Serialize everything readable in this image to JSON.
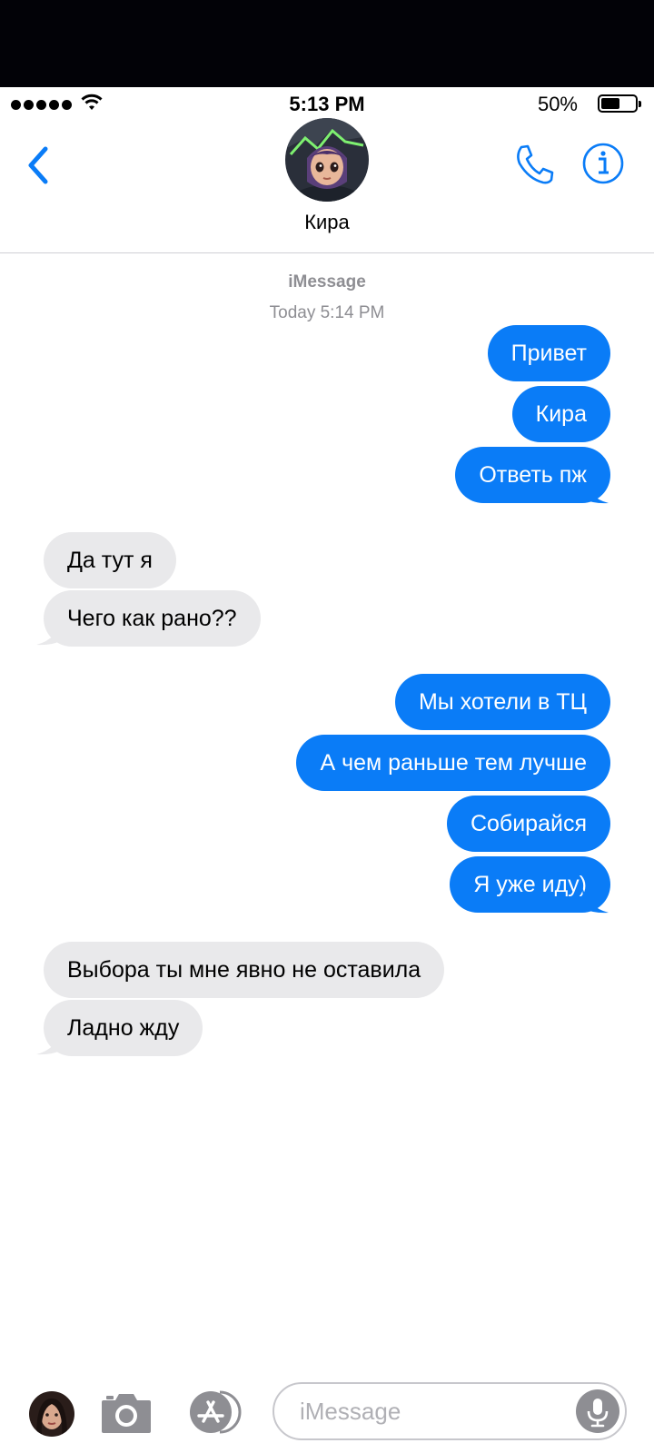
{
  "status_bar": {
    "time": "5:13 PM",
    "battery_percent": "50%",
    "battery_level": 0.5,
    "signal_bars": 5
  },
  "header": {
    "contact_name": "Кира",
    "back_icon": "chevron-left-icon",
    "call_icon": "phone-icon",
    "info_icon": "info-icon",
    "accent_color": "#0a7cf7"
  },
  "conversation": {
    "service": "iMessage",
    "timestamp": "Today 5:14 PM",
    "messages": [
      {
        "from": "me",
        "text": "Привет"
      },
      {
        "from": "me",
        "text": "Кира"
      },
      {
        "from": "me",
        "text": "Ответь пж"
      },
      {
        "from": "them",
        "text": "Да тут я"
      },
      {
        "from": "them",
        "text": "Чего как рано??"
      },
      {
        "from": "me",
        "text": "Мы хотели в ТЦ"
      },
      {
        "from": "me",
        "text": "А чем раньше тем лучше"
      },
      {
        "from": "me",
        "text": "Собирайся"
      },
      {
        "from": "me",
        "text": "Я уже иду)"
      },
      {
        "from": "them",
        "text": "Выбора ты мне явно не оставила"
      },
      {
        "from": "them",
        "text": "Ладно жду"
      }
    ],
    "sent_color": "#0a7cf7",
    "received_color": "#e9e9eb"
  },
  "input_bar": {
    "placeholder": "iMessage",
    "camera_icon": "camera-icon",
    "apps_icon": "app-store-icon",
    "mic_icon": "microphone-icon"
  }
}
